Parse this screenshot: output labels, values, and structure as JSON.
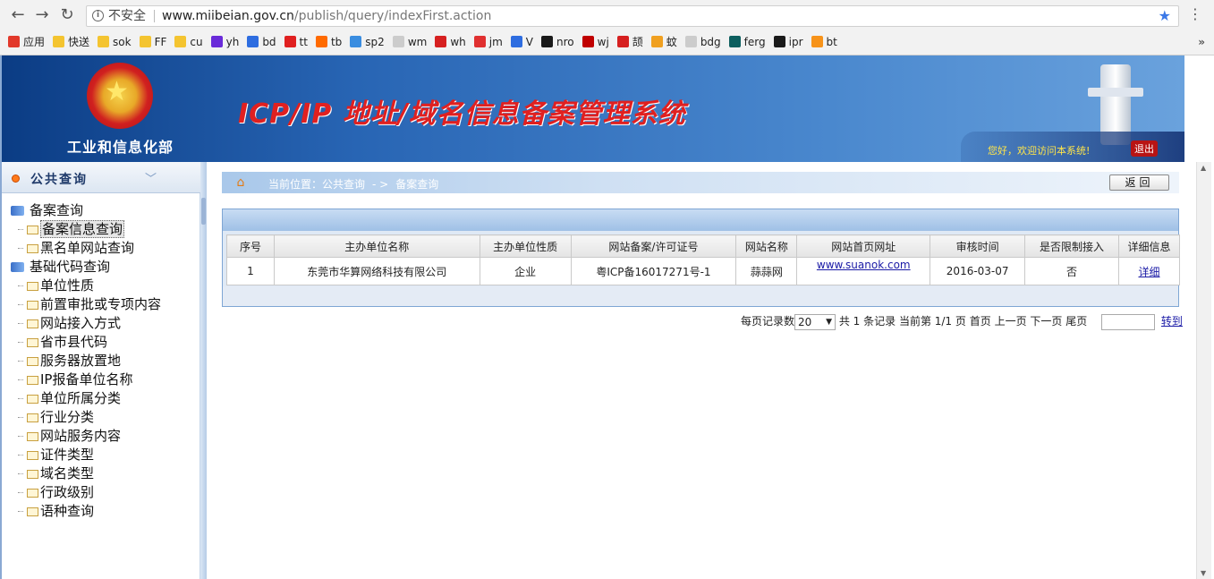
{
  "browser": {
    "security_label": "不安全",
    "url_host": "www.miibeian.gov.cn",
    "url_path": "/publish/query/indexFirst.action",
    "bookmarks": [
      {
        "label": "应用",
        "color": "#e2392b"
      },
      {
        "label": "快送",
        "color": "#f4c430"
      },
      {
        "label": "sok",
        "color": "#f4c430"
      },
      {
        "label": "FF",
        "color": "#f4c430"
      },
      {
        "label": "cu",
        "color": "#f4c430"
      },
      {
        "label": "yh",
        "color": "#6a2bd9"
      },
      {
        "label": "bd",
        "color": "#2e6de0"
      },
      {
        "label": "tt",
        "color": "#e02020"
      },
      {
        "label": "tb",
        "color": "#ff6a00"
      },
      {
        "label": "sp2",
        "color": "#3a8de0"
      },
      {
        "label": "wm",
        "color": "#cccccc"
      },
      {
        "label": "wh",
        "color": "#d62020"
      },
      {
        "label": "jm",
        "color": "#e03030"
      },
      {
        "label": "V",
        "color": "#2e6de0"
      },
      {
        "label": "nro",
        "color": "#1a1a1a"
      },
      {
        "label": "wj",
        "color": "#c00000"
      },
      {
        "label": "颉",
        "color": "#d62020"
      },
      {
        "label": "蚊",
        "color": "#f0a020"
      },
      {
        "label": "bdg",
        "color": "#cccccc"
      },
      {
        "label": "ferg",
        "color": "#0d5f5f"
      },
      {
        "label": "ipr",
        "color": "#1a1a1a"
      },
      {
        "label": "bt",
        "color": "#f7931a"
      }
    ],
    "more": "»"
  },
  "header": {
    "ministry": "工业和信息化部",
    "system_title": "ICP/IP 地址/域名信息备案管理系统",
    "welcome": "您好，欢迎访问本系统!",
    "logout": "退出"
  },
  "sidebar": {
    "title": "公共查询",
    "groups": [
      {
        "label": "备案查询",
        "items": [
          "备案信息查询",
          "黑名单网站查询"
        ]
      },
      {
        "label": "基础代码查询",
        "items": [
          "单位性质",
          "前置审批或专项内容",
          "网站接入方式",
          "省市县代码",
          "服务器放置地",
          "IP报备单位名称",
          "单位所属分类",
          "行业分类",
          "网站服务内容",
          "证件类型",
          "域名类型",
          "行政级别",
          "语种查询"
        ]
      }
    ],
    "selected": "备案信息查询"
  },
  "breadcrumb": {
    "prefix": "当前位置：公共查询",
    "separator": "- >",
    "current": "备案查询",
    "back_button": "返回"
  },
  "results": {
    "columns": [
      "序号",
      "主办单位名称",
      "主办单位性质",
      "网站备案/许可证号",
      "网站名称",
      "网站首页网址",
      "审核时间",
      "是否限制接入",
      "详细信息"
    ],
    "rows": [
      {
        "index": "1",
        "org": "东莞市华算网络科技有限公司",
        "org_type": "企业",
        "license": "粤ICP备16017271号-1",
        "site_name": "蒜蒜网",
        "url": "www.suanok.com",
        "date": "2016-03-07",
        "restricted": "否",
        "detail": "详细"
      }
    ]
  },
  "pager": {
    "per_page_label": "每页记录数",
    "per_page_value": "20",
    "total": "共 1 条记录",
    "current": "当前第 1/1 页",
    "first": "首页",
    "prev": "上一页",
    "next": "下一页",
    "last": "尾页",
    "goto": "转到"
  }
}
